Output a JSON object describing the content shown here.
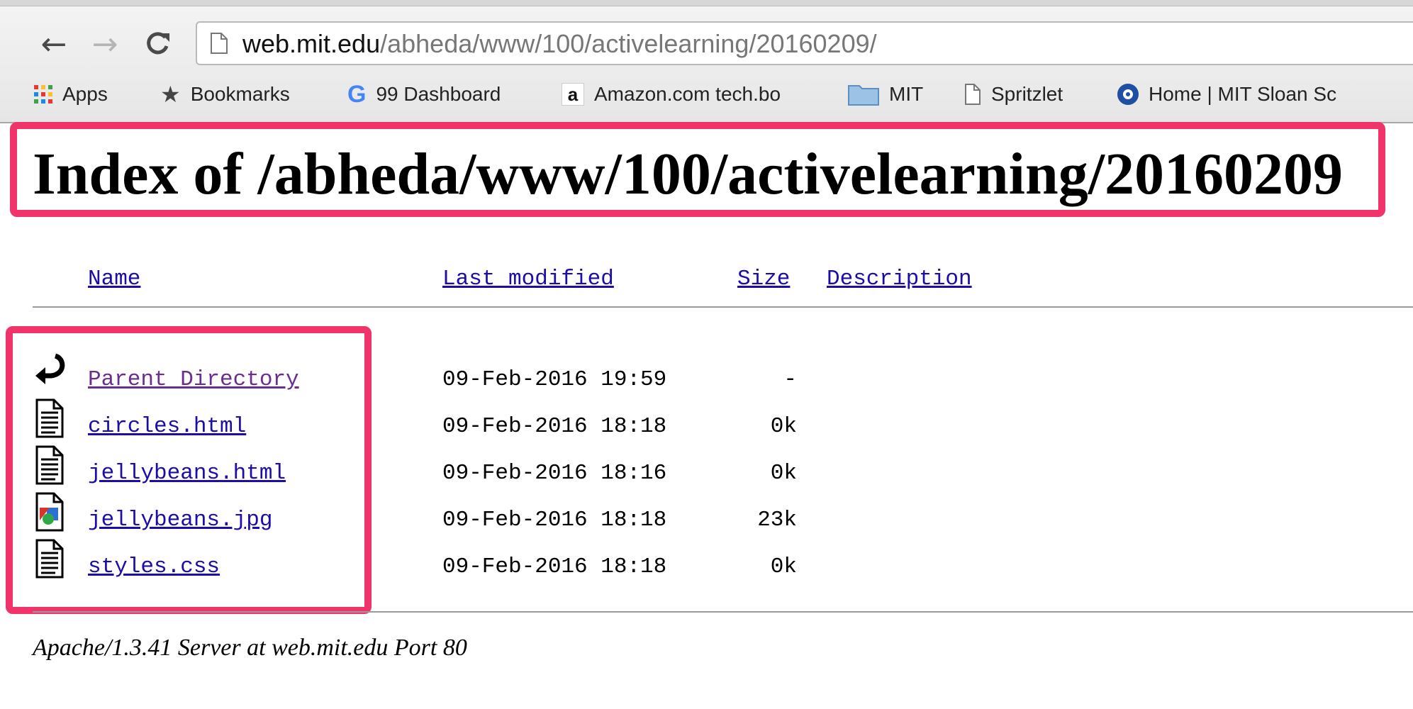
{
  "browser": {
    "url_host": "web.mit.edu",
    "url_path": "/abheda/www/100/activelearning/20160209/",
    "bookmarks": [
      {
        "label": "Apps",
        "icon": "apps-grid-icon"
      },
      {
        "label": "Bookmarks",
        "icon": "star-icon"
      },
      {
        "label": "99 Dashboard",
        "icon": "google-icon"
      },
      {
        "label": "Amazon.com tech.bo",
        "icon": "amazon-icon"
      },
      {
        "label": "MIT",
        "icon": "folder-icon"
      },
      {
        "label": "Spritzlet",
        "icon": "page-icon"
      },
      {
        "label": "Home | MIT Sloan Sc",
        "icon": "sloan-icon"
      }
    ]
  },
  "page": {
    "title": "Index of /abheda/www/100/activelearning/20160209",
    "headers": {
      "name": "Name",
      "last_modified": "Last modified",
      "size": "Size",
      "description": "Description"
    },
    "rows": [
      {
        "name": "Parent Directory",
        "date": "09-Feb-2016 19:59",
        "size": "-",
        "icon": "back-arrow-icon"
      },
      {
        "name": "circles.html",
        "date": "09-Feb-2016 18:18",
        "size": "0k",
        "icon": "text-file-icon"
      },
      {
        "name": "jellybeans.html",
        "date": "09-Feb-2016 18:16",
        "size": "0k",
        "icon": "text-file-icon"
      },
      {
        "name": "jellybeans.jpg",
        "date": "09-Feb-2016 18:18",
        "size": "23k",
        "icon": "image-file-icon"
      },
      {
        "name": "styles.css",
        "date": "09-Feb-2016 18:18",
        "size": "0k",
        "icon": "text-file-icon"
      }
    ],
    "footer": "Apache/1.3.41 Server at web.mit.edu Port 80"
  },
  "colors": {
    "highlight": "#f0346a",
    "link": "#1a0dab",
    "visited": "#6b2d8f"
  }
}
